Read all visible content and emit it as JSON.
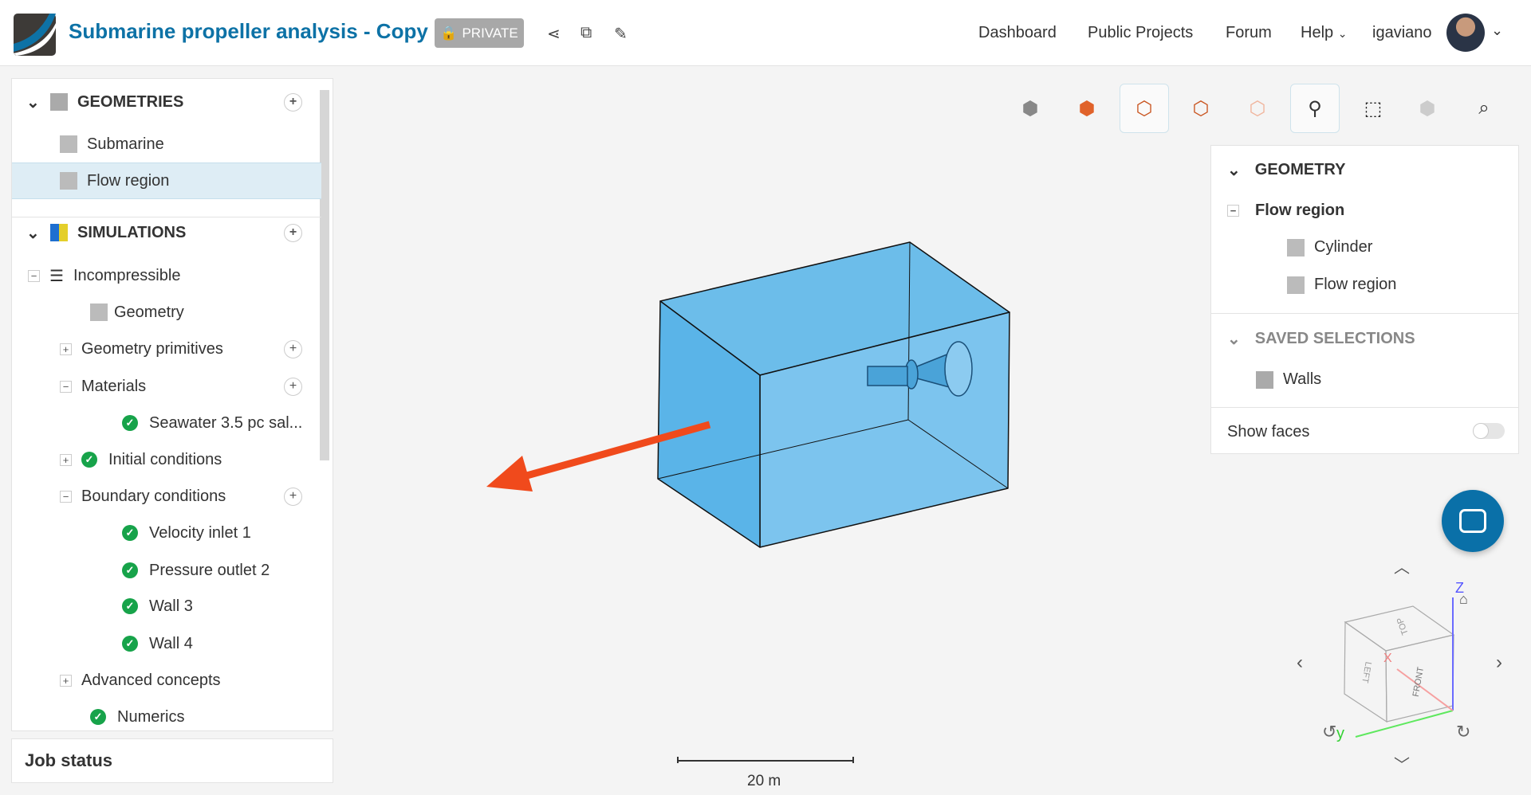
{
  "header": {
    "title": "Submarine propeller analysis - Copy",
    "badge": "PRIVATE",
    "nav": [
      "Dashboard",
      "Public Projects",
      "Forum",
      "Help"
    ],
    "user": "igaviano"
  },
  "sidebar": {
    "geometries": {
      "label": "GEOMETRIES",
      "items": [
        "Submarine",
        "Flow region"
      ]
    },
    "simulations": {
      "label": "SIMULATIONS",
      "items": [
        "Incompressible",
        "Geometry",
        "Geometry primitives",
        "Materials",
        "Seawater 3.5 pc sal...",
        "Initial conditions",
        "Boundary conditions",
        "Velocity inlet 1",
        "Pressure outlet 2",
        "Wall 3",
        "Wall 4",
        "Advanced concepts",
        "Numerics"
      ]
    },
    "job_status": "Job status"
  },
  "right_panel": {
    "geometry_label": "GEOMETRY",
    "parent": "Flow region",
    "children": [
      "Cylinder",
      "Flow region"
    ],
    "saved_label": "SAVED SELECTIONS",
    "saved": [
      "Walls"
    ],
    "show_faces": "Show faces",
    "show_faces_on": false
  },
  "viewport": {
    "scale_label": "20 m",
    "axes": {
      "x": "X",
      "y": "y",
      "z": "Z"
    },
    "cube_faces": {
      "front": "FRONT",
      "left": "LEFT",
      "top": "TOP"
    }
  },
  "colors": {
    "brand": "#0d72a6",
    "box": "#5ab4e8",
    "arrow": "#f04a1c",
    "check": "#17a34a"
  }
}
